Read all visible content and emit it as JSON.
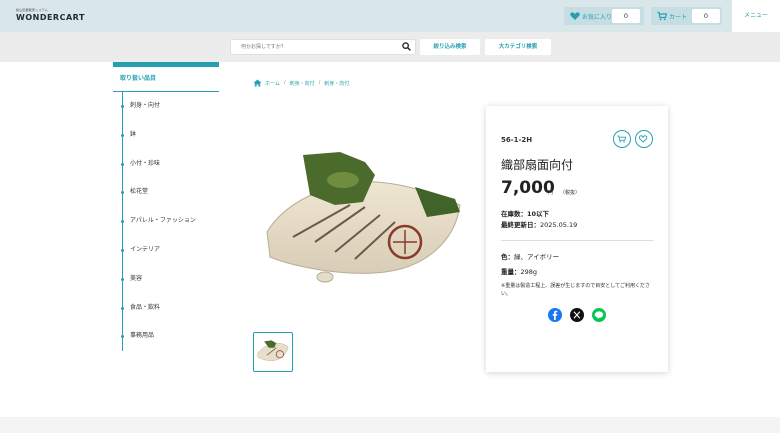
{
  "header": {
    "logo_tagline": "和山田器販売システム",
    "logo": "WONDERCART",
    "favorites_label": "お気に入り",
    "favorites_count": "0",
    "cart_label": "カート",
    "cart_count": "0",
    "menu_label": "メニュー"
  },
  "search": {
    "placeholder": "何かお探しですか？",
    "filter_button": "絞り込み検索",
    "category_button": "大カテゴリ検索"
  },
  "sidebar": {
    "title": "取り扱い品目",
    "items": [
      "刺身・向付",
      "鉢",
      "小付・珍味",
      "松花堂",
      "アパレル・ファッション",
      "インテリア",
      "美容",
      "食品・飲料",
      "事務用品"
    ]
  },
  "breadcrumb": [
    "ホーム",
    "刺身・向付",
    "刺身・向付"
  ],
  "product": {
    "code": "56-1-2H",
    "name": "織部扇面向付",
    "price": "7,000",
    "currency": "円",
    "tax_note": "（税抜）",
    "stock_label": "在庫数：",
    "stock_value": "10以下",
    "updated_label": "最終更新日：",
    "updated_value": "2025.05.19",
    "color_label": "色：",
    "color_value": "緑、アイボリー",
    "weight_label": "重量：",
    "weight_value": "298g",
    "note": "※重量は製造工程上、誤差が生じますので目安としてご利用ください。"
  },
  "icons": [
    "home-icon",
    "heart-icon",
    "cart-icon",
    "search-icon",
    "facebook-icon",
    "x-icon",
    "line-icon"
  ],
  "colors": {
    "accent": "#26a0b0",
    "header_bg": "#d9e6ea",
    "facebook": "#1877f2",
    "line": "#06c755"
  }
}
